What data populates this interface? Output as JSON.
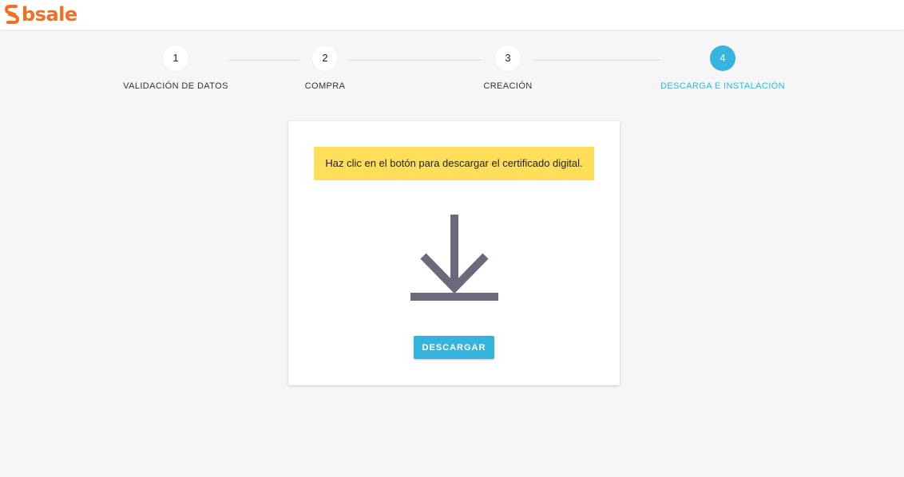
{
  "brand": {
    "name": "bsale",
    "color": "#f36f21",
    "logo_icon": "bsale-logo-icon"
  },
  "stepper": {
    "active_color": "#35b5dd",
    "steps": [
      {
        "number": "1",
        "label": "VALIDACIÓN DE DATOS",
        "active": false
      },
      {
        "number": "2",
        "label": "COMPRA",
        "active": false
      },
      {
        "number": "3",
        "label": "CREACIÓN",
        "active": false
      },
      {
        "number": "4",
        "label": "DESCARGA E INSTALACIÓN",
        "active": true
      }
    ]
  },
  "card": {
    "notice": "Haz clic en el botón para descargar el certificado digital.",
    "notice_color": "#ffde59",
    "icon": "download-icon",
    "button_label": "DESCARGAR"
  }
}
